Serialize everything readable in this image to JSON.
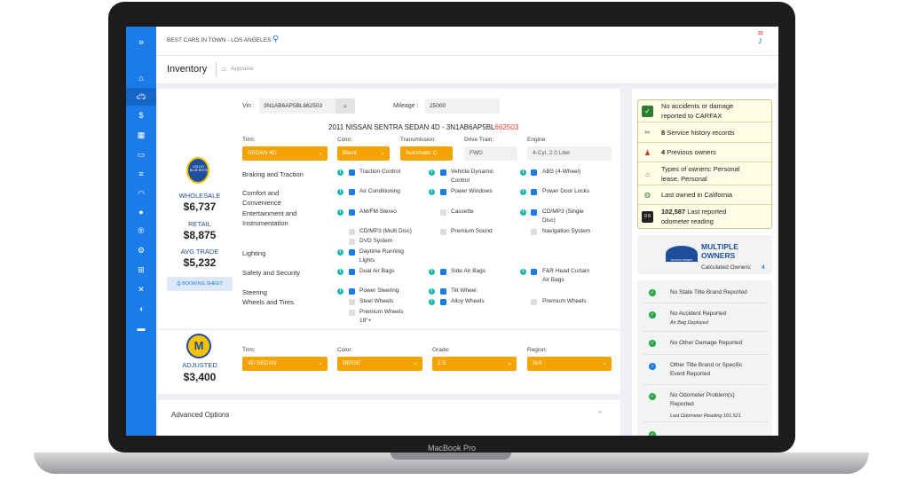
{
  "device": {
    "brand": "MacBook Pro"
  },
  "topbar": {
    "dealer": "BEST CARS IN TOWN - LOS ANGELES",
    "notif_count": "33"
  },
  "header": {
    "title": "Inventory",
    "breadcrumb": "Appraise"
  },
  "vin": {
    "label": "Vin :",
    "value": "3N1AB6AP5BL662503",
    "mileage_label": "Mileage :",
    "mileage_value": "25000"
  },
  "vehicle": {
    "title_main": "2011  NISSAN  SENTRA  SEDAN 4D - 3N1AB6AP5BL",
    "title_red": "662503"
  },
  "fields": {
    "trim_label": "Trim:",
    "trim_value": "SEDAN 4D",
    "color_label": "Color:",
    "color_value": "Black",
    "trans_label": "Transmission:",
    "trans_value": "Automatic C",
    "drive_label": "Drive Train:",
    "drive_value": "FWD",
    "engine_label": "Engine:",
    "engine_value": "4-Cyl, 2.0 Liter"
  },
  "kbb": {
    "logo_text": "KELLEY BLUE BOOK",
    "wholesale_label": "WHOLESALE",
    "wholesale_value": "$6,737",
    "retail_label": "RETAIL",
    "retail_value": "$8,875",
    "avg_label": "AVG TRADE",
    "avg_value": "$5,232",
    "booking_button": "BOOKING SHEET"
  },
  "categories": {
    "braking": "Braking and Traction",
    "comfort1": "Comfort and",
    "comfort2": "Convenience",
    "ent1": "Entertainment and",
    "ent2": "Instrumentation",
    "lighting": "Lighting",
    "safety": "Safety and Security",
    "steering": "Steering",
    "wheels": "Wheels and Tires"
  },
  "options": {
    "traction": "Traction Control",
    "vdc1": "Vehicle Dynamic",
    "vdc2": "Control",
    "abs": "ABS (4-Wheel)",
    "ac": "Air Conditioning",
    "pw": "Power Windows",
    "pdl": "Power Door Locks",
    "amfm": "AM/FM Stereo",
    "cassette": "Cassette",
    "cd1": "CD/MP3 (Single",
    "cd2": "Disc)",
    "cdmulti": "CD/MP3 (Multi Disc)",
    "sat": "Premium Sound",
    "nav": "Navigation System",
    "dvd": "DVD System",
    "drl1": "Daytime Running",
    "drl2": "Lights",
    "dab": "Dual Air Bags",
    "sab": "Side Air Bags",
    "curtain1": "F&R Head Curtain",
    "curtain2": "Air Bags",
    "ps": "Power Steering",
    "tilt": "Tilt Wheel",
    "steel": "Steel Wheels",
    "alloy": "Alloy Wheels",
    "pw19a": "Premium Wheels",
    "pw19b": "19\"+",
    "premwheels": "Premium Wheels"
  },
  "manheim": {
    "adjusted_label": "ADJUSTED",
    "adjusted_value": "$3,400",
    "trim_label": "Trim:",
    "trim_value": "4D SEDAN",
    "color_label": "Color:",
    "color_value": "BEIGE",
    "grade_label": "Grade:",
    "grade_value": "2.5",
    "region_label": "Region:",
    "region_value": "N/A"
  },
  "advanced": {
    "label": "Advanced Options"
  },
  "carfax": [
    {
      "text1": "No accidents or damage",
      "text2": "reported to CARFAX",
      "icon": "check-icon"
    },
    {
      "bold": "8",
      "text1": " Service history records",
      "icon": "tools-icon"
    },
    {
      "bold": "4",
      "text1": " Previous owners",
      "icon": "owners-icon"
    },
    {
      "text1": "Types of owners: Personal",
      "text2": "lease, Personal",
      "icon": "house-icon"
    },
    {
      "text1": "Last owned in California",
      "icon": "globe-icon"
    },
    {
      "bold": "102,587",
      "text1": " Last reported",
      "text2": "odometer reading",
      "icon": "odometer-icon"
    }
  ],
  "multiple_owners": {
    "line1": "MULTIPLE",
    "line2": "OWNERS",
    "calc_label": "Calculated Owners:",
    "calc_value": "4",
    "badge": "MULTIPLE OWNERS"
  },
  "history": [
    {
      "text1": "No State Title Brand Reported"
    },
    {
      "text1": "No Accident Reported",
      "sub": "Air Bag Deployed"
    },
    {
      "text1": "No Other Damage Reported"
    },
    {
      "text1": "Other Title Brand or Specific",
      "text2": "Event Reported"
    },
    {
      "text1": "No Odometer Problem(s)",
      "text2": "Reported",
      "sub": "Last Odometer Reading 101,521"
    }
  ],
  "colors": {
    "blue": "#1a7be9",
    "orange": "#f5a300",
    "green": "#27a744"
  }
}
